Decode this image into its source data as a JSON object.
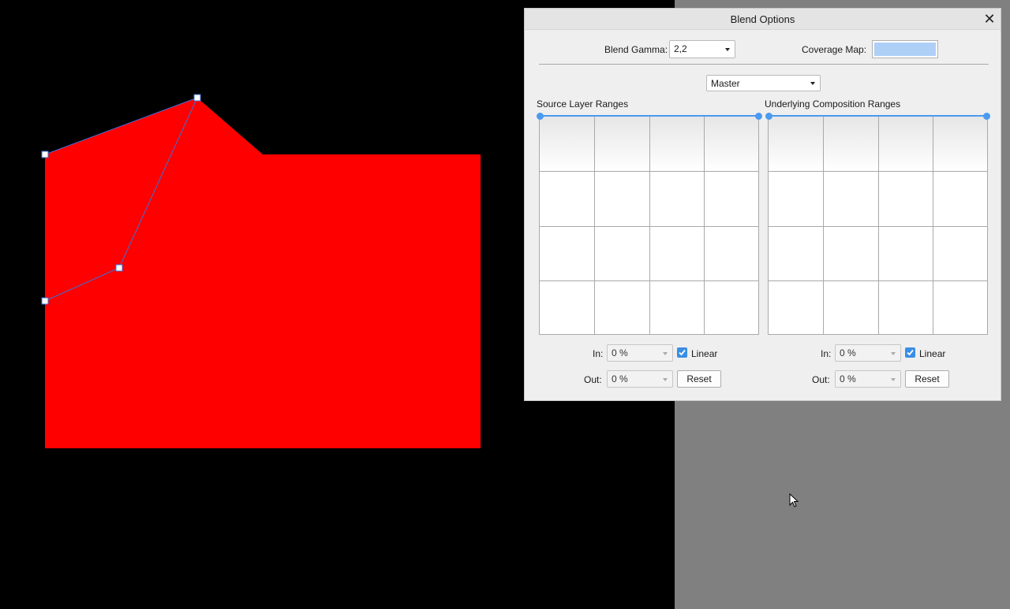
{
  "colors": {
    "canvas_background": "#000000",
    "pasteboard": "#808080",
    "shape_fill": "#ff0000",
    "selection_path": "#3a6fd8",
    "accent": "#4a9af0",
    "coverage_map_swatch": "#aed0f7"
  },
  "canvas": {
    "selected_shape": "red-polygon",
    "node_icon": "square-node-icon",
    "cursor_icon": "arrow-cursor-icon"
  },
  "dialog": {
    "title": "Blend Options",
    "close_glyph": "✕",
    "blend_gamma": {
      "label": "Blend Gamma:",
      "value": "2,2"
    },
    "coverage_map": {
      "label": "Coverage Map:"
    },
    "channel": {
      "value": "Master"
    },
    "source": {
      "title": "Source Layer Ranges",
      "in_label": "In:",
      "in_value": "0 %",
      "out_label": "Out:",
      "out_value": "0 %",
      "linear_label": "Linear",
      "linear_checked": true,
      "reset_label": "Reset"
    },
    "underlying": {
      "title": "Underlying Composition Ranges",
      "in_label": "In:",
      "in_value": "0 %",
      "out_label": "Out:",
      "out_value": "0 %",
      "linear_label": "Linear",
      "linear_checked": true,
      "reset_label": "Reset"
    }
  }
}
